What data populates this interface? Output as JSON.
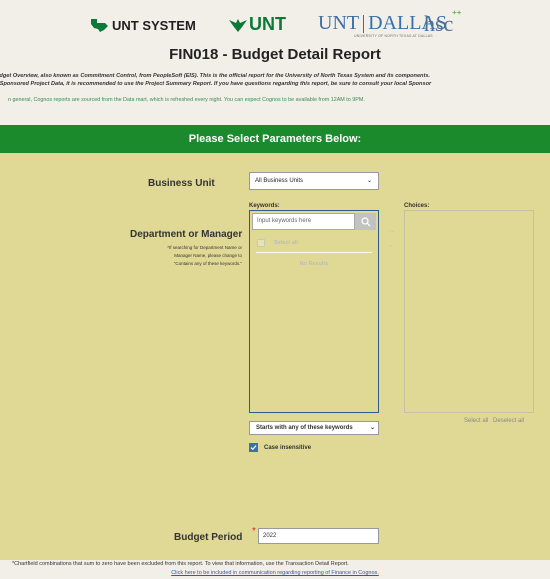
{
  "header": {
    "logos": {
      "unt_system": "UNT SYSTEM",
      "unt": "UNT",
      "dallas_left": "UNT",
      "dallas_right": "DALLAS",
      "dallas_sub": "UNIVERSITY OF NORTH TEXAS AT DALLAS",
      "hsc": "hsc"
    },
    "title": "FIN018 - Budget Detail Report",
    "intro_line1": "udget Overview, also known as Commitment Control, from PeopleSoft (EIS). This is the official report for the University of North Texas System and its components.",
    "intro_line2": "r Sponsored Project Data, it is recommended to use the Project Summary Report. If you have questions regarding this report, be sure to consult your local Sponsor",
    "note": "n general, Cognos reports are sourced from the Data mart, which is refreshed every night. You can expect Cognos to be available from 12AM to 9PM."
  },
  "banner": {
    "text": "Please Select Parameters Below:"
  },
  "business_unit": {
    "label": "Business Unit",
    "selected": "All Business Units"
  },
  "department": {
    "label": "Department or Manager",
    "help_line1": "*If searching for Department Name or",
    "help_line2": "Manager Name, please change to",
    "help_line3": "\"Contains any of these keywords.\"",
    "keywords_label": "Keywords:",
    "keywords_placeholder": "Input keywords here",
    "choices_label": "Choices:",
    "select_all": "Select all",
    "no_results": "No Results",
    "match_mode": "Starts with any of these keywords",
    "case_insensitive": "Case insensitive",
    "choices_select_all": "Select all",
    "choices_deselect_all": "Deselect all"
  },
  "budget_period": {
    "label": "Budget Period",
    "required_mark": "*",
    "value": "2022"
  },
  "footer": {
    "note": "*Chartfield combinations that sum to zero have been excluded from this report. To view that information, use the Transaction Detail Report.",
    "link": "Click here to be included in communication regarding reporting of Finance in Cognos."
  },
  "colors": {
    "background": "#e0d995",
    "banner": "#1b8a2c",
    "header": "#f1efe7",
    "checkbox": "#3a6fb0"
  }
}
